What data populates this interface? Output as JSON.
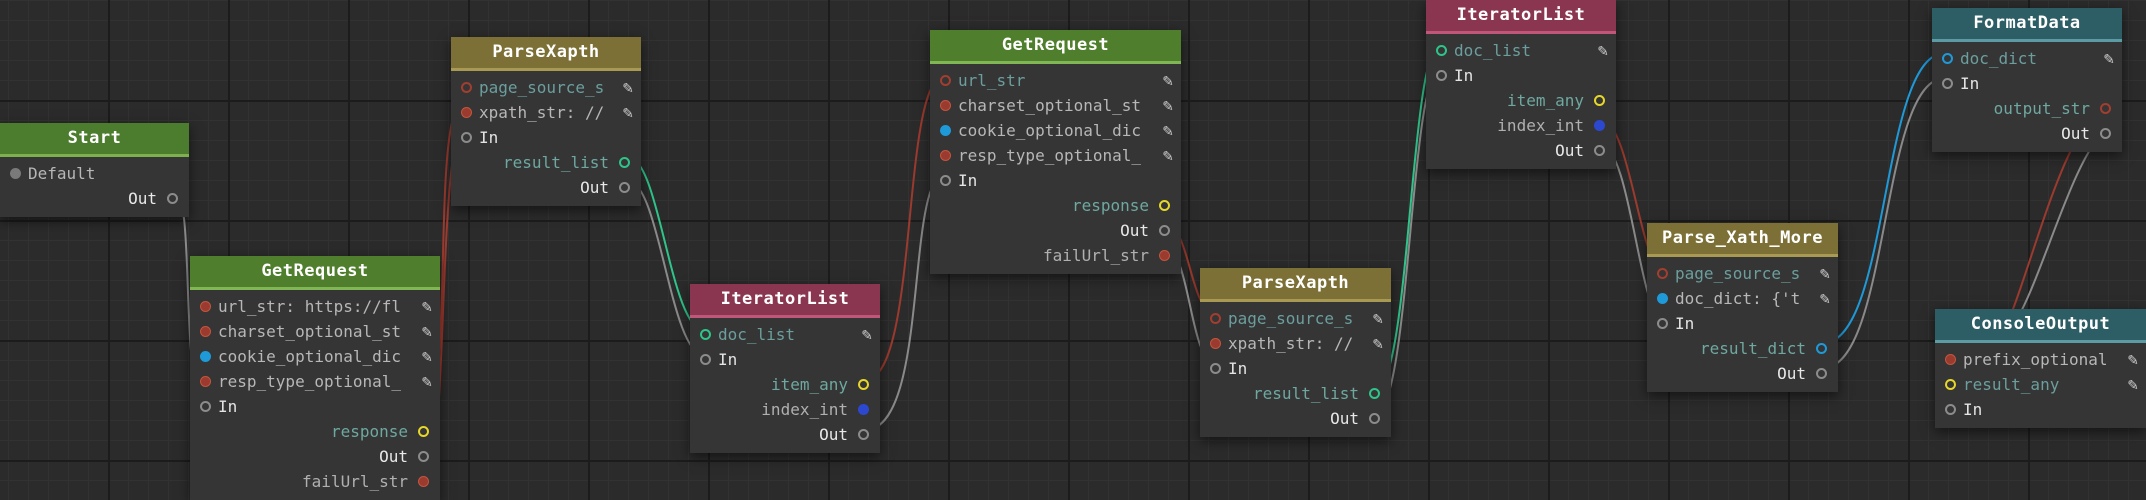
{
  "nodes": {
    "start": {
      "title": "Start",
      "default_label": "Default",
      "out_label": "Out"
    },
    "get1": {
      "title": "GetRequest",
      "url": "url_str: https://fl",
      "charset": "charset_optional_st",
      "cookie": "cookie_optional_dic",
      "resp_type": "resp_type_optional_",
      "in_label": "In",
      "response": "response",
      "out_label": "Out",
      "fail": "failUrl_str"
    },
    "parse1": {
      "title": "ParseXapth",
      "page_source": "page_source_s",
      "xpath": "xpath_str: //",
      "in_label": "In",
      "result": "result_list",
      "out_label": "Out"
    },
    "iter1": {
      "title": "IteratorList",
      "doc_list": "doc_list",
      "in_label": "In",
      "item": "item_any",
      "index": "index_int",
      "out_label": "Out"
    },
    "get2": {
      "title": "GetRequest",
      "url": "url_str",
      "charset": "charset_optional_st",
      "cookie": "cookie_optional_dic",
      "resp_type": "resp_type_optional_",
      "in_label": "In",
      "response": "response",
      "out_label": "Out",
      "fail": "failUrl_str"
    },
    "parse2": {
      "title": "ParseXapth",
      "page_source": "page_source_s",
      "xpath": "xpath_str: //",
      "in_label": "In",
      "result": "result_list",
      "out_label": "Out"
    },
    "iter2": {
      "title": "IteratorList",
      "doc_list": "doc_list",
      "in_label": "In",
      "item": "item_any",
      "index": "index_int",
      "out_label": "Out"
    },
    "parse3": {
      "title": "Parse_Xath_More",
      "page_source": "page_source_s",
      "doc_dict": "doc_dict: {'t",
      "in_label": "In",
      "result": "result_dict",
      "out_label": "Out"
    },
    "fmt": {
      "title": "FormatData",
      "doc_dict": "doc_dict",
      "in_label": "In",
      "output": "output_str",
      "out_label": "Out"
    },
    "console": {
      "title": "ConsoleOutput",
      "prefix": "prefix_optional",
      "result": "result_any",
      "in_label": "In"
    }
  },
  "icons": {
    "edit": "edit-icon"
  },
  "colors": {
    "background": "#2b2b2b",
    "node_body": "#353535",
    "wire_red": "#9b3a2e",
    "wire_grey": "#8a8a8a",
    "wire_green": "#2ec48a",
    "wire_blue": "#1e9ad8",
    "port_yellow": "#e6d72a"
  }
}
